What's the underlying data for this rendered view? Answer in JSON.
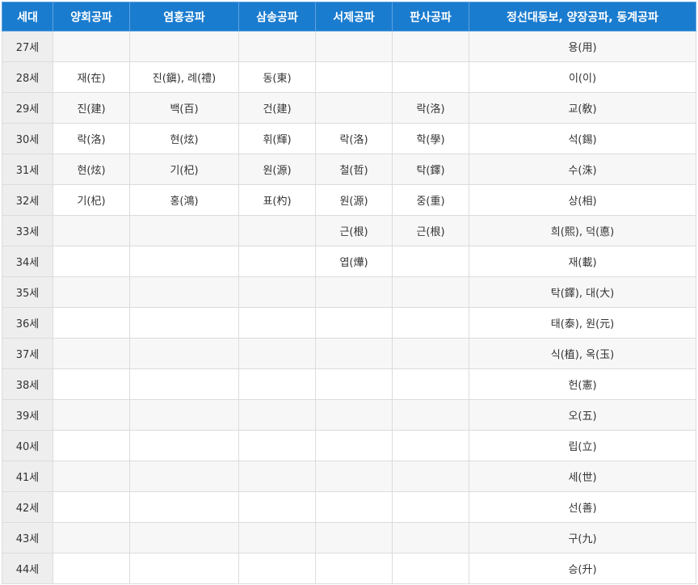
{
  "table": {
    "headers": [
      "세대",
      "양회공파",
      "염흥공파",
      "삼송공파",
      "서제공파",
      "판사공파",
      "정선대동보, 양장공파, 동계공파"
    ],
    "rows": [
      [
        "27세",
        "",
        "",
        "",
        "",
        "",
        "용(用)"
      ],
      [
        "28세",
        "재(在)",
        "진(鎭), 례(禮)",
        "동(東)",
        "",
        "",
        "이(이)"
      ],
      [
        "29세",
        "진(建)",
        "백(百)",
        "건(建)",
        "",
        "락(洛)",
        "교(敎)"
      ],
      [
        "30세",
        "락(洛)",
        "현(炫)",
        "휘(輝)",
        "락(洛)",
        "학(學)",
        "석(錫)"
      ],
      [
        "31세",
        "현(炫)",
        "기(杞)",
        "원(源)",
        "철(哲)",
        "탁(鐸)",
        "수(洙)"
      ],
      [
        "32세",
        "기(杞)",
        "홍(鴻)",
        "표(杓)",
        "원(源)",
        "중(重)",
        "상(相)"
      ],
      [
        "33세",
        "",
        "",
        "",
        "근(根)",
        "근(根)",
        "희(熙), 덕(悳)"
      ],
      [
        "34세",
        "",
        "",
        "",
        "엽(燁)",
        "",
        "재(載)"
      ],
      [
        "35세",
        "",
        "",
        "",
        "",
        "",
        "탁(鐸), 대(大)"
      ],
      [
        "36세",
        "",
        "",
        "",
        "",
        "",
        "태(泰), 원(元)"
      ],
      [
        "37세",
        "",
        "",
        "",
        "",
        "",
        "식(植), 옥(玉)"
      ],
      [
        "38세",
        "",
        "",
        "",
        "",
        "",
        "헌(憲)"
      ],
      [
        "39세",
        "",
        "",
        "",
        "",
        "",
        "오(五)"
      ],
      [
        "40세",
        "",
        "",
        "",
        "",
        "",
        "립(立)"
      ],
      [
        "41세",
        "",
        "",
        "",
        "",
        "",
        "세(世)"
      ],
      [
        "42세",
        "",
        "",
        "",
        "",
        "",
        "선(善)"
      ],
      [
        "43세",
        "",
        "",
        "",
        "",
        "",
        "구(九)"
      ],
      [
        "44세",
        "",
        "",
        "",
        "",
        "",
        "승(升)"
      ]
    ]
  },
  "colors": {
    "header_bg": "#1a7ccf",
    "header_text": "#ffffff",
    "stripe": "#f7f7f7",
    "generation_cell_bg": "#eeeeee",
    "border": "#dcdcdc"
  }
}
